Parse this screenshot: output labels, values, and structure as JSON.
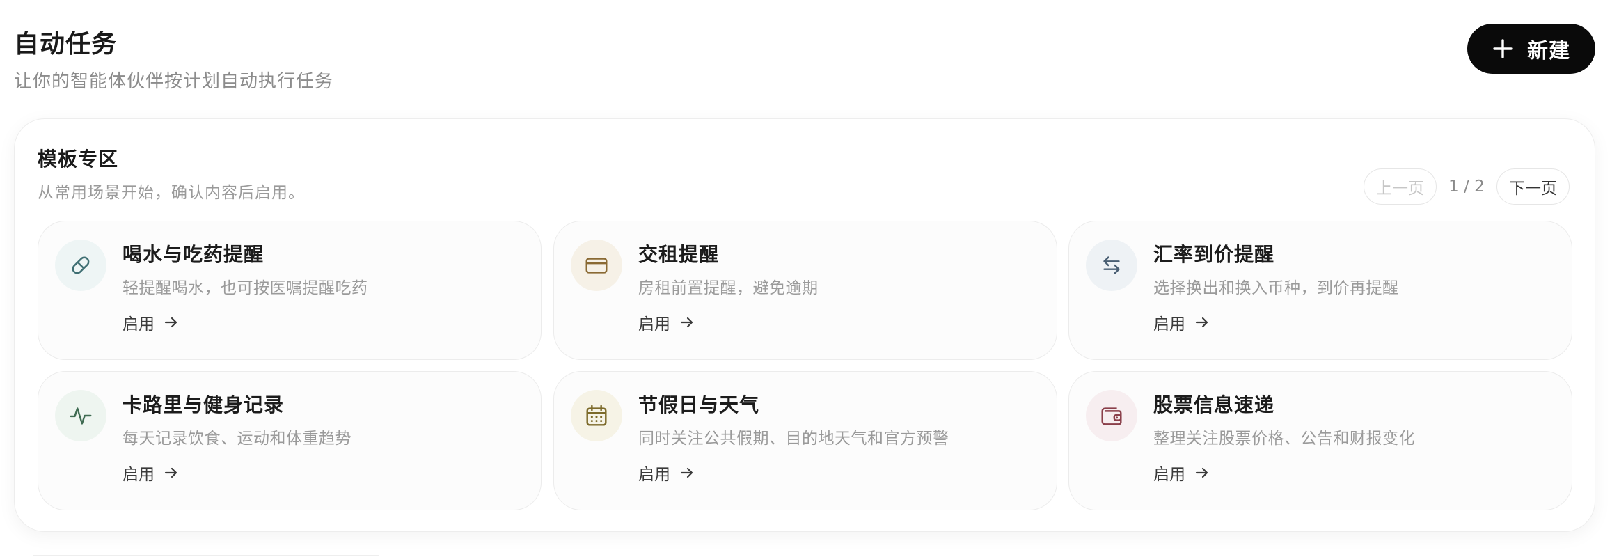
{
  "header": {
    "title": "自动任务",
    "subtitle": "让你的智能体伙伴按计划自动执行任务",
    "new_button_label": "新建"
  },
  "templates": {
    "title": "模板专区",
    "description": "从常用场景开始，确认内容后启用。",
    "pager": {
      "prev_label": "上一页",
      "page_indicator": "1 / 2",
      "next_label": "下一页"
    },
    "cards": [
      {
        "title": "喝水与吃药提醒",
        "description": "轻提醒喝水，也可按医嘱提醒吃药",
        "action_label": "启用",
        "icon": "pill-icon",
        "icon_color": "#3f6f73",
        "icon_bg": "#eef5f5"
      },
      {
        "title": "交租提醒",
        "description": "房租前置提醒，避免逾期",
        "action_label": "启用",
        "icon": "credit-card-icon",
        "icon_color": "#8a6a34",
        "icon_bg": "#f6f1e7"
      },
      {
        "title": "汇率到价提醒",
        "description": "选择换出和换入币种，到价再提醒",
        "action_label": "启用",
        "icon": "exchange-arrows-icon",
        "icon_color": "#4a5f73",
        "icon_bg": "#eef2f5"
      },
      {
        "title": "卡路里与健身记录",
        "description": "每天记录饮食、运动和体重趋势",
        "action_label": "启用",
        "icon": "activity-pulse-icon",
        "icon_color": "#3f6b52",
        "icon_bg": "#eef5f0"
      },
      {
        "title": "节假日与天气",
        "description": "同时关注公共假期、目的地天气和官方预警",
        "action_label": "启用",
        "icon": "calendar-icon",
        "icon_color": "#7c6a2a",
        "icon_bg": "#f6f3e6"
      },
      {
        "title": "股票信息速递",
        "description": "整理关注股票价格、公告和财报变化",
        "action_label": "启用",
        "icon": "wallet-icon",
        "icon_color": "#8a3f4a",
        "icon_bg": "#f7eef0"
      }
    ]
  }
}
